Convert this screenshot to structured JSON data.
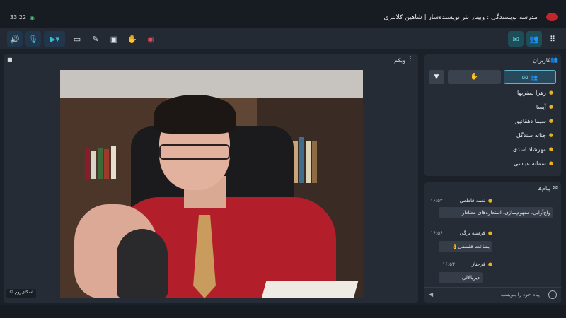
{
  "topbar": {
    "time": "33:22",
    "title": "مدرسه نویسندگی : وبینار نثر نویسنده‌ساز | شاهین کلانتری"
  },
  "video": {
    "panel_label": "وبکم",
    "user_label": "اسکای‌روم ©"
  },
  "users": {
    "panel_label": "کاربران",
    "count": "۵۵",
    "list": [
      "زهرا صفریها",
      "آیسا",
      "سیما دهقانپور",
      "جنانه سندگل",
      "مهرشاد اسدی",
      "سمانه عباسی"
    ]
  },
  "messages": {
    "panel_label": "پیام‌ها",
    "items": [
      {
        "author": "نغمه قاطمی",
        "time": "۱۶:۵۴",
        "text": "واج‌آرایی، مفهوم‌سازی، استعاره‌های معتادار"
      },
      {
        "author": "فرشته برگی",
        "time": "۱۶:۵۶",
        "text": "بضاعت فلسفی👌"
      },
      {
        "author": "فرحناز",
        "time": "۱۶:۵۳",
        "text": "دیرپالالی"
      }
    ],
    "input_placeholder": "پیام خود را بنویسید"
  },
  "colors": {
    "accent": "#38b7d6",
    "user_icon": "#e6b21e",
    "record": "#e04a5f"
  }
}
